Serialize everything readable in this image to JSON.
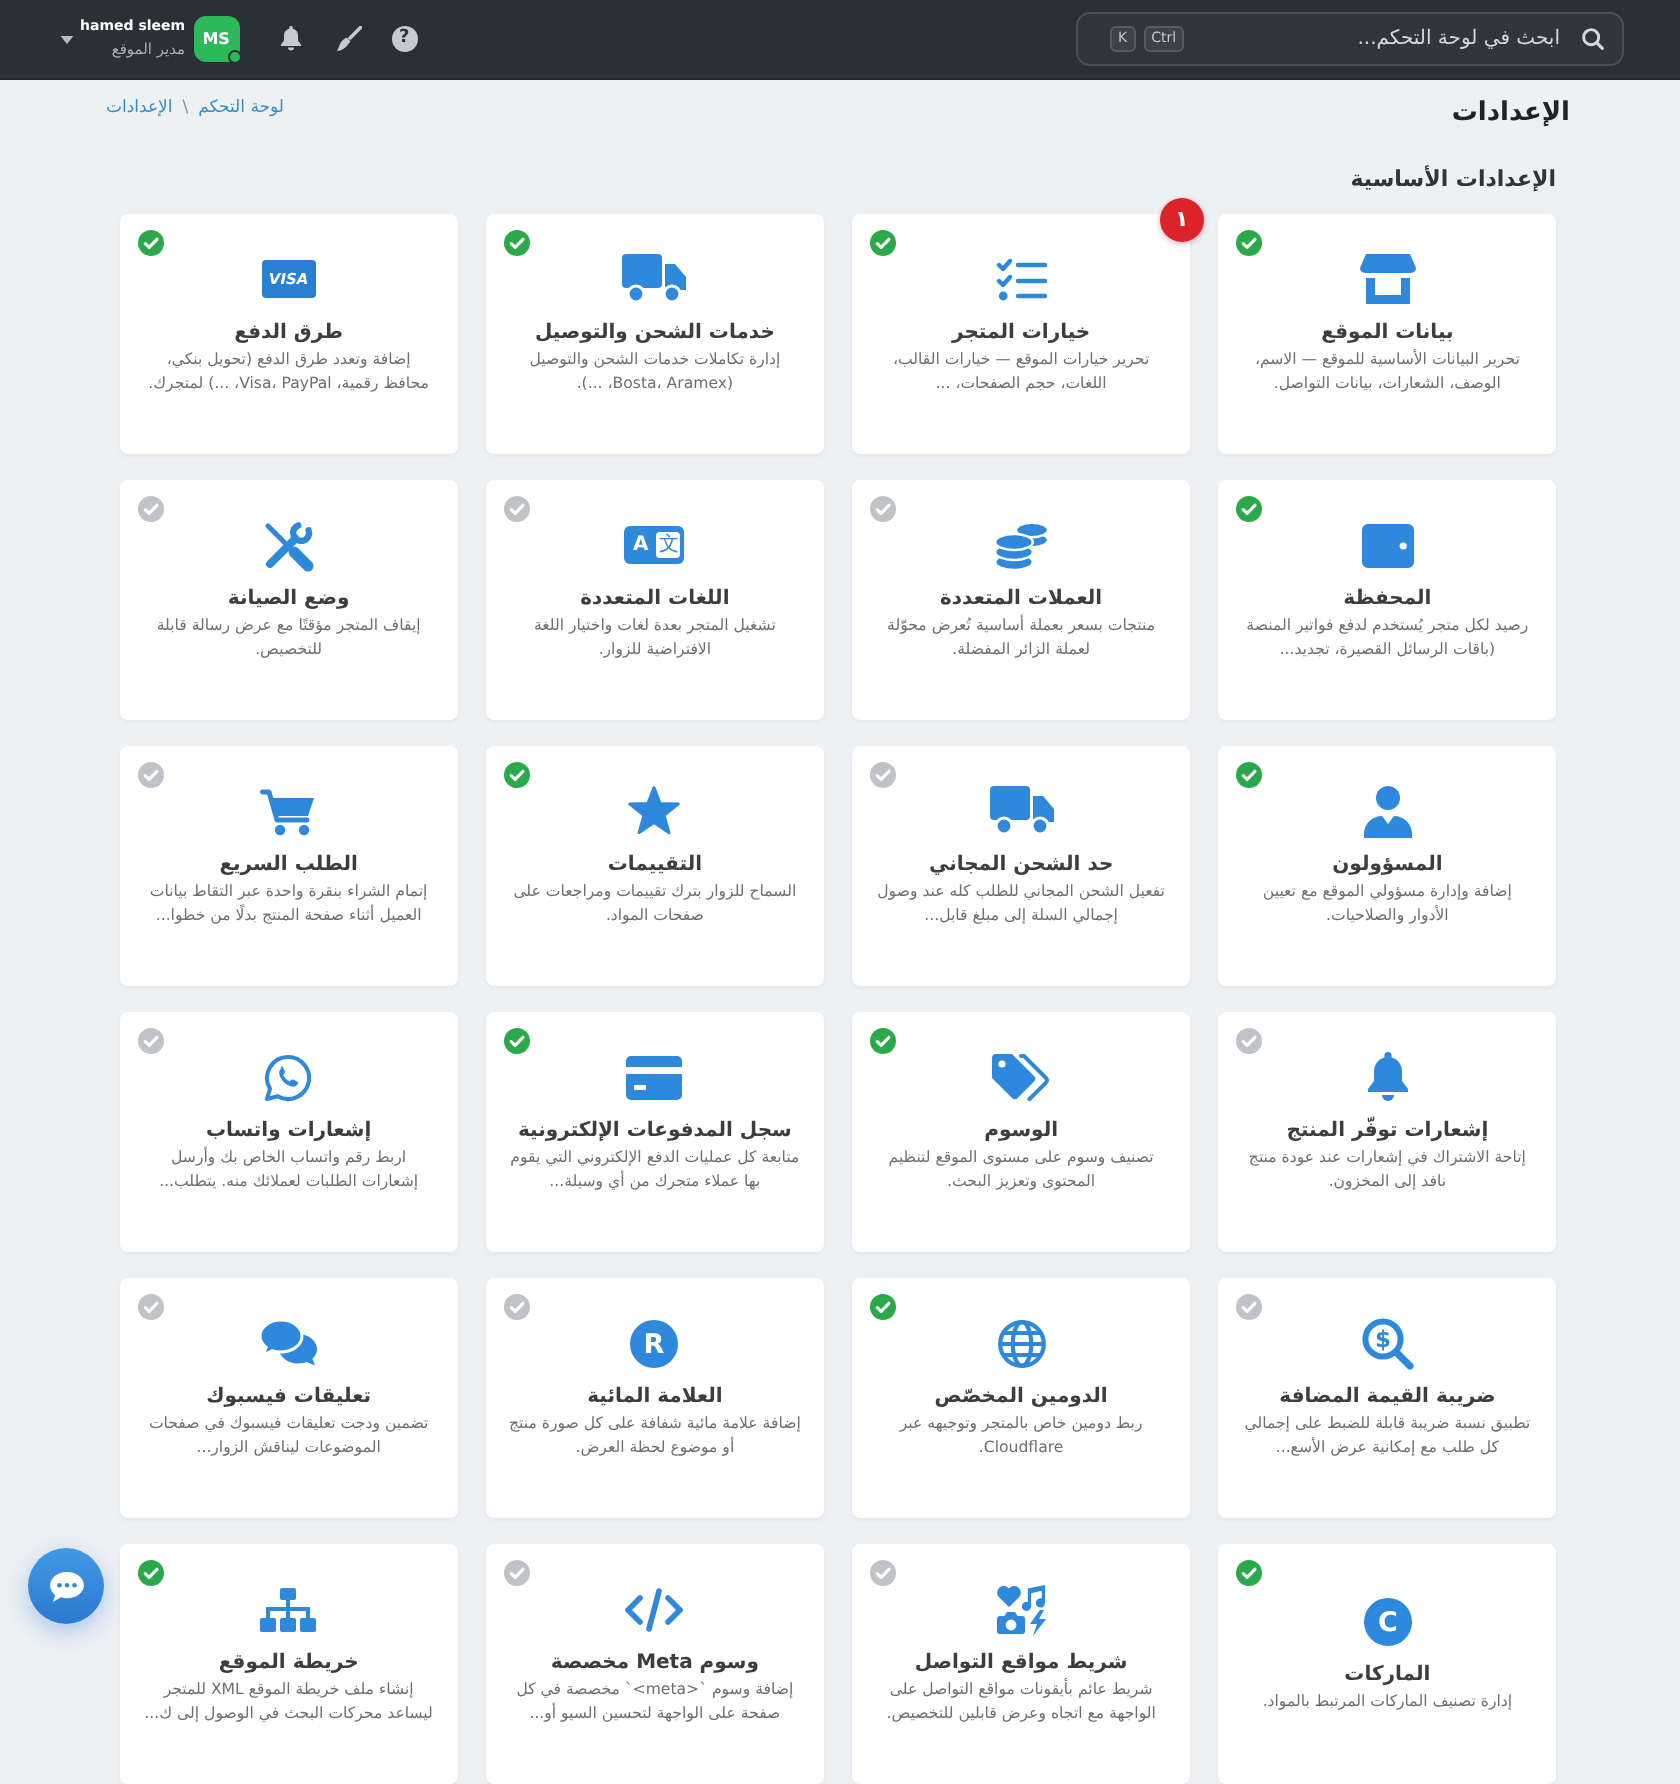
{
  "topbar": {
    "search": {
      "placeholder": "ابحث في لوحة التحكم...",
      "shortcut_keys": [
        "Ctrl",
        "K"
      ]
    },
    "help": "?",
    "user": {
      "initials": "MS",
      "online": true,
      "name": "hamed sleem",
      "role": "مدير الموقع"
    }
  },
  "page": {
    "title": "الإعدادات",
    "breadcrumb": [
      "لوحة التحكم",
      "الإعدادات"
    ],
    "breadcrumb_separator": "\\"
  },
  "section": {
    "title": "الإعدادات الأساسية",
    "cards": [
      {
        "title": "بيانات الموقع",
        "description": "تحرير البيانات الأساسية للموقع — الاسم، الوصف، الشعارات، بيانات التواصل.",
        "enabled": true
      },
      {
        "title": "خيارات المتجر",
        "description": "تحرير خيارات الموقع — خيارات القالب، اللغات، حجم الصفحات، ...",
        "enabled": true,
        "badge": "١"
      },
      {
        "title": "خدمات الشحن والتوصيل",
        "description": "إدارة تكاملات خدمات الشحن والتوصيل (Bosta، Aramex، ...).",
        "enabled": true
      },
      {
        "title": "طرق الدفع",
        "description": "إضافة وتعدد طرق الدفع (تحويل بنكي، محافظ رقمية، Visa، PayPal، ...) لمتجرك.",
        "enabled": true,
        "icon_texts": [
          "VISA"
        ]
      },
      {
        "title": "المحفظة",
        "description": "رصيد لكل متجر يُستخدم لدفع فواتير المنصة (باقات الرسائل القصيرة، تجديد...",
        "enabled": true
      },
      {
        "title": "العملات المتعددة",
        "description": "منتجات بسعر بعملة أساسية تُعرض محوّلة لعملة الزائر المفضلة.",
        "enabled": false
      },
      {
        "title": "اللغات المتعددة",
        "description": "تشغيل المتجر بعدة لغات واختيار اللغة الافتراضية للزوار.",
        "enabled": false,
        "icon_texts": [
          "文",
          "A"
        ]
      },
      {
        "title": "وضع الصيانة",
        "description": "إيقاف المتجر مؤقتًا مع عرض رسالة قابلة للتخصيص.",
        "enabled": false
      },
      {
        "title": "المسؤولون",
        "description": "إضافة وإدارة مسؤولي الموقع مع تعيين الأدوار والصلاحيات.",
        "enabled": true
      },
      {
        "title": "حد الشحن المجاني",
        "description": "تفعيل الشحن المجاني للطلب كله عند وصول إجمالي السلة إلى مبلغ قابل...",
        "enabled": false
      },
      {
        "title": "التقييمات",
        "description": "السماح للزوار بترك تقييمات ومراجعات على صفحات المواد.",
        "enabled": true
      },
      {
        "title": "الطلب السريع",
        "description": "إتمام الشراء بنقرة واحدة عبر التقاط بيانات العميل أثناء صفحة المنتج بدلًا من خطوا...",
        "enabled": false
      },
      {
        "title": "إشعارات توفّر المنتج",
        "description": "إتاحة الاشتراك في إشعارات عند عودة منتج نافد إلى المخزون.",
        "enabled": false
      },
      {
        "title": "الوسوم",
        "description": "تصنيف وسوم على مستوى الموقع لتنظيم المحتوى وتعزيز البحث.",
        "enabled": true
      },
      {
        "title": "سجل المدفوعات الإلكترونية",
        "description": "متابعة كل عمليات الدفع الإلكتروني التي يقوم بها عملاء متجرك من أي وسيلة...",
        "enabled": true
      },
      {
        "title": "إشعارات واتساب",
        "description": "اربط رقم واتساب الخاص بك وأرسل إشعارات الطلبات لعملائك منه. يتطلب...",
        "enabled": false
      },
      {
        "title": "ضريبة القيمة المضافة",
        "description": "تطبيق نسبة ضريبة قابلة للضبط على إجمالي كل طلب مع إمكانية عرض الأسع...",
        "enabled": false,
        "icon_texts": [
          "$"
        ]
      },
      {
        "title": "الدومين المخصّص",
        "description": "ربط دومين خاص بالمتجر وتوجيهه عبر Cloudflare.",
        "enabled": true
      },
      {
        "title": "العلامة المائية",
        "description": "إضافة علامة مائية شفافة على كل صورة منتج أو موضوع لحظة العرض.",
        "enabled": false,
        "icon_texts": [
          "R"
        ]
      },
      {
        "title": "تعليقات فيسبوك",
        "description": "تضمين ودجت تعليقات فيسبوك في صفحات الموضوعات ليناقش الزوار...",
        "enabled": false
      },
      {
        "title": "الماركات",
        "description": "إدارة تصنيف الماركات المرتبط بالمواد.",
        "enabled": true,
        "icon_texts": [
          "C"
        ]
      },
      {
        "title": "شريط مواقع التواصل",
        "description": "شريط عائم بأيقونات مواقع التواصل على الواجهة مع اتجاه وعرض قابلين للتخصيص.",
        "enabled": false
      },
      {
        "title": "وسوم Meta مخصصة",
        "description": "إضافة وسوم `<meta>` مخصصة في كل صفحة على الواجهة لتحسين السيو أو...",
        "enabled": false
      },
      {
        "title": "خريطة الموقع",
        "description": "إنشاء ملف خريطة الموقع XML للمتجر ليساعد محركات البحث في الوصول إلى ك...",
        "enabled": true
      }
    ]
  }
}
